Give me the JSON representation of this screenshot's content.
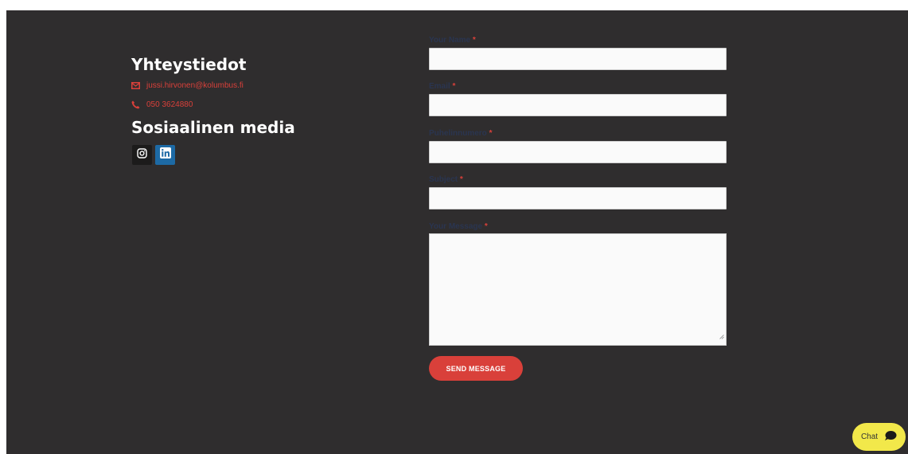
{
  "contact": {
    "heading": "Yhteystiedot",
    "email": "jussi.hirvonen@kolumbus.fi",
    "phone": "050 3624880",
    "email_icon": "envelope-icon",
    "phone_icon": "phone-icon"
  },
  "social": {
    "heading": "Sosiaalinen media",
    "items": [
      {
        "icon": "instagram-icon",
        "color": "#1c1b1b"
      },
      {
        "icon": "linkedin-icon",
        "color": "#1d6aa5"
      }
    ]
  },
  "form": {
    "required_mark": "*",
    "fields": [
      {
        "label": "Your Name",
        "value": ""
      },
      {
        "label": "Email",
        "value": ""
      },
      {
        "label": "Puhelinnumero",
        "value": ""
      },
      {
        "label": "Subject",
        "value": ""
      },
      {
        "label": "Your Message",
        "value": ""
      }
    ],
    "submit_label": "SEND MESSAGE"
  },
  "chat": {
    "label": "Chat",
    "icon": "chat-bubble-icon",
    "color": "#f2e84a"
  },
  "colors": {
    "background": "#2f2d2e",
    "accent": "#d9403a",
    "heading": "#ffffff"
  }
}
